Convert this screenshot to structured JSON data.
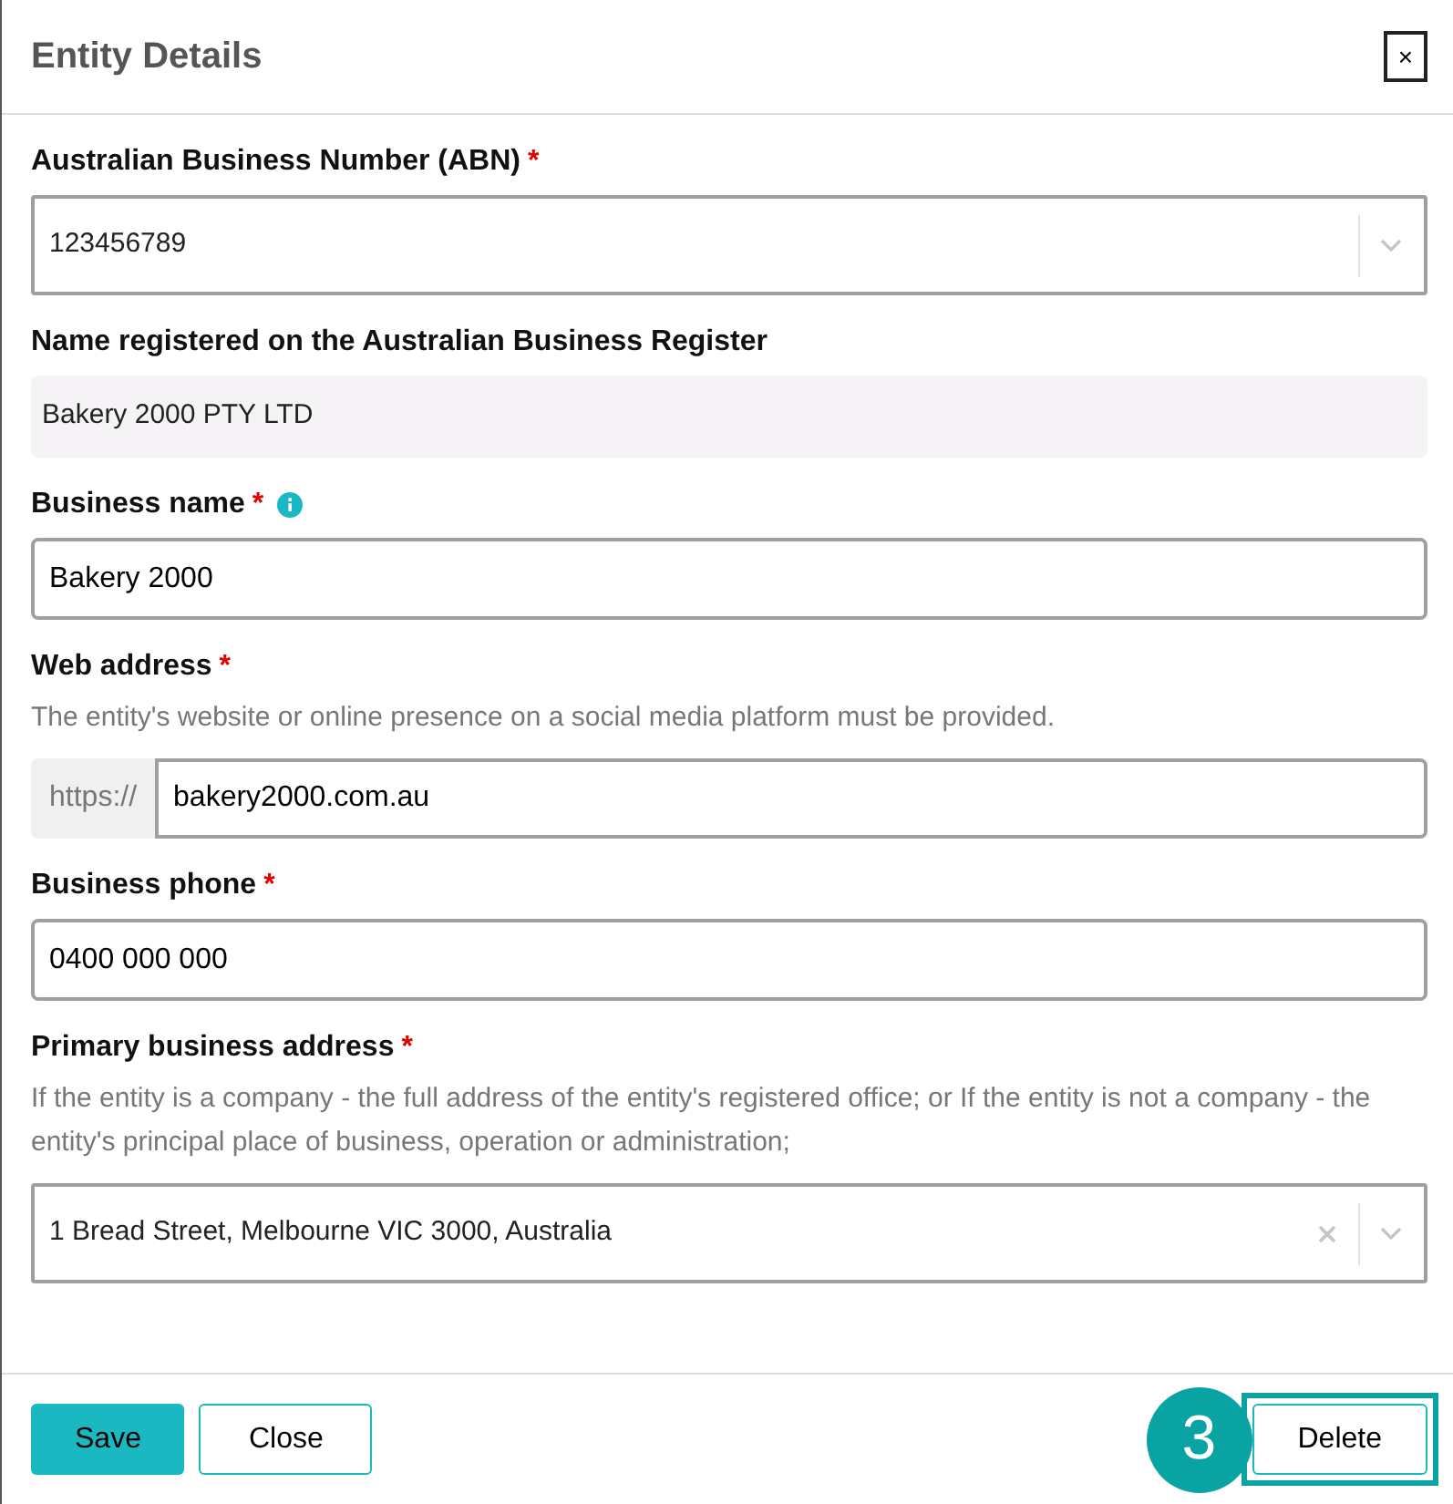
{
  "dialog": {
    "title": "Entity Details",
    "close_label": "×"
  },
  "fields": [
    {
      "kind": "select",
      "label": "Australian Business Number (ABN)",
      "required_mark": "*",
      "value": "123456789",
      "clearable": false
    },
    {
      "kind": "readonly",
      "label": "Name registered on the Australian Business Register",
      "value": "Bakery 2000 PTY LTD"
    },
    {
      "kind": "text",
      "label": "Business name",
      "required_mark": "*",
      "info": true,
      "value": "Bakery 2000"
    },
    {
      "kind": "prefixed",
      "label": "Web address",
      "required_mark": "*",
      "help": "The entity's website or online presence on a social media platform must be provided.",
      "prefix": "https://",
      "value": "bakery2000.com.au"
    },
    {
      "kind": "text",
      "label": "Business phone",
      "required_mark": "*",
      "value": "0400 000 000"
    },
    {
      "kind": "select",
      "label": "Primary business address",
      "required_mark": "*",
      "help": "If the entity is a company - the full address of the entity's registered office; or If the entity is not a company - the entity's principal place of business, operation or administration;",
      "value": "1 Bread Street, Melbourne VIC 3000, Australia",
      "clearable": true
    }
  ],
  "footer": {
    "buttons": [
      {
        "label": "Save",
        "kind": "primary"
      },
      {
        "label": "Close",
        "kind": "outline"
      }
    ],
    "delete": {
      "label": "Delete",
      "highlighted": true,
      "callout": "3"
    }
  }
}
